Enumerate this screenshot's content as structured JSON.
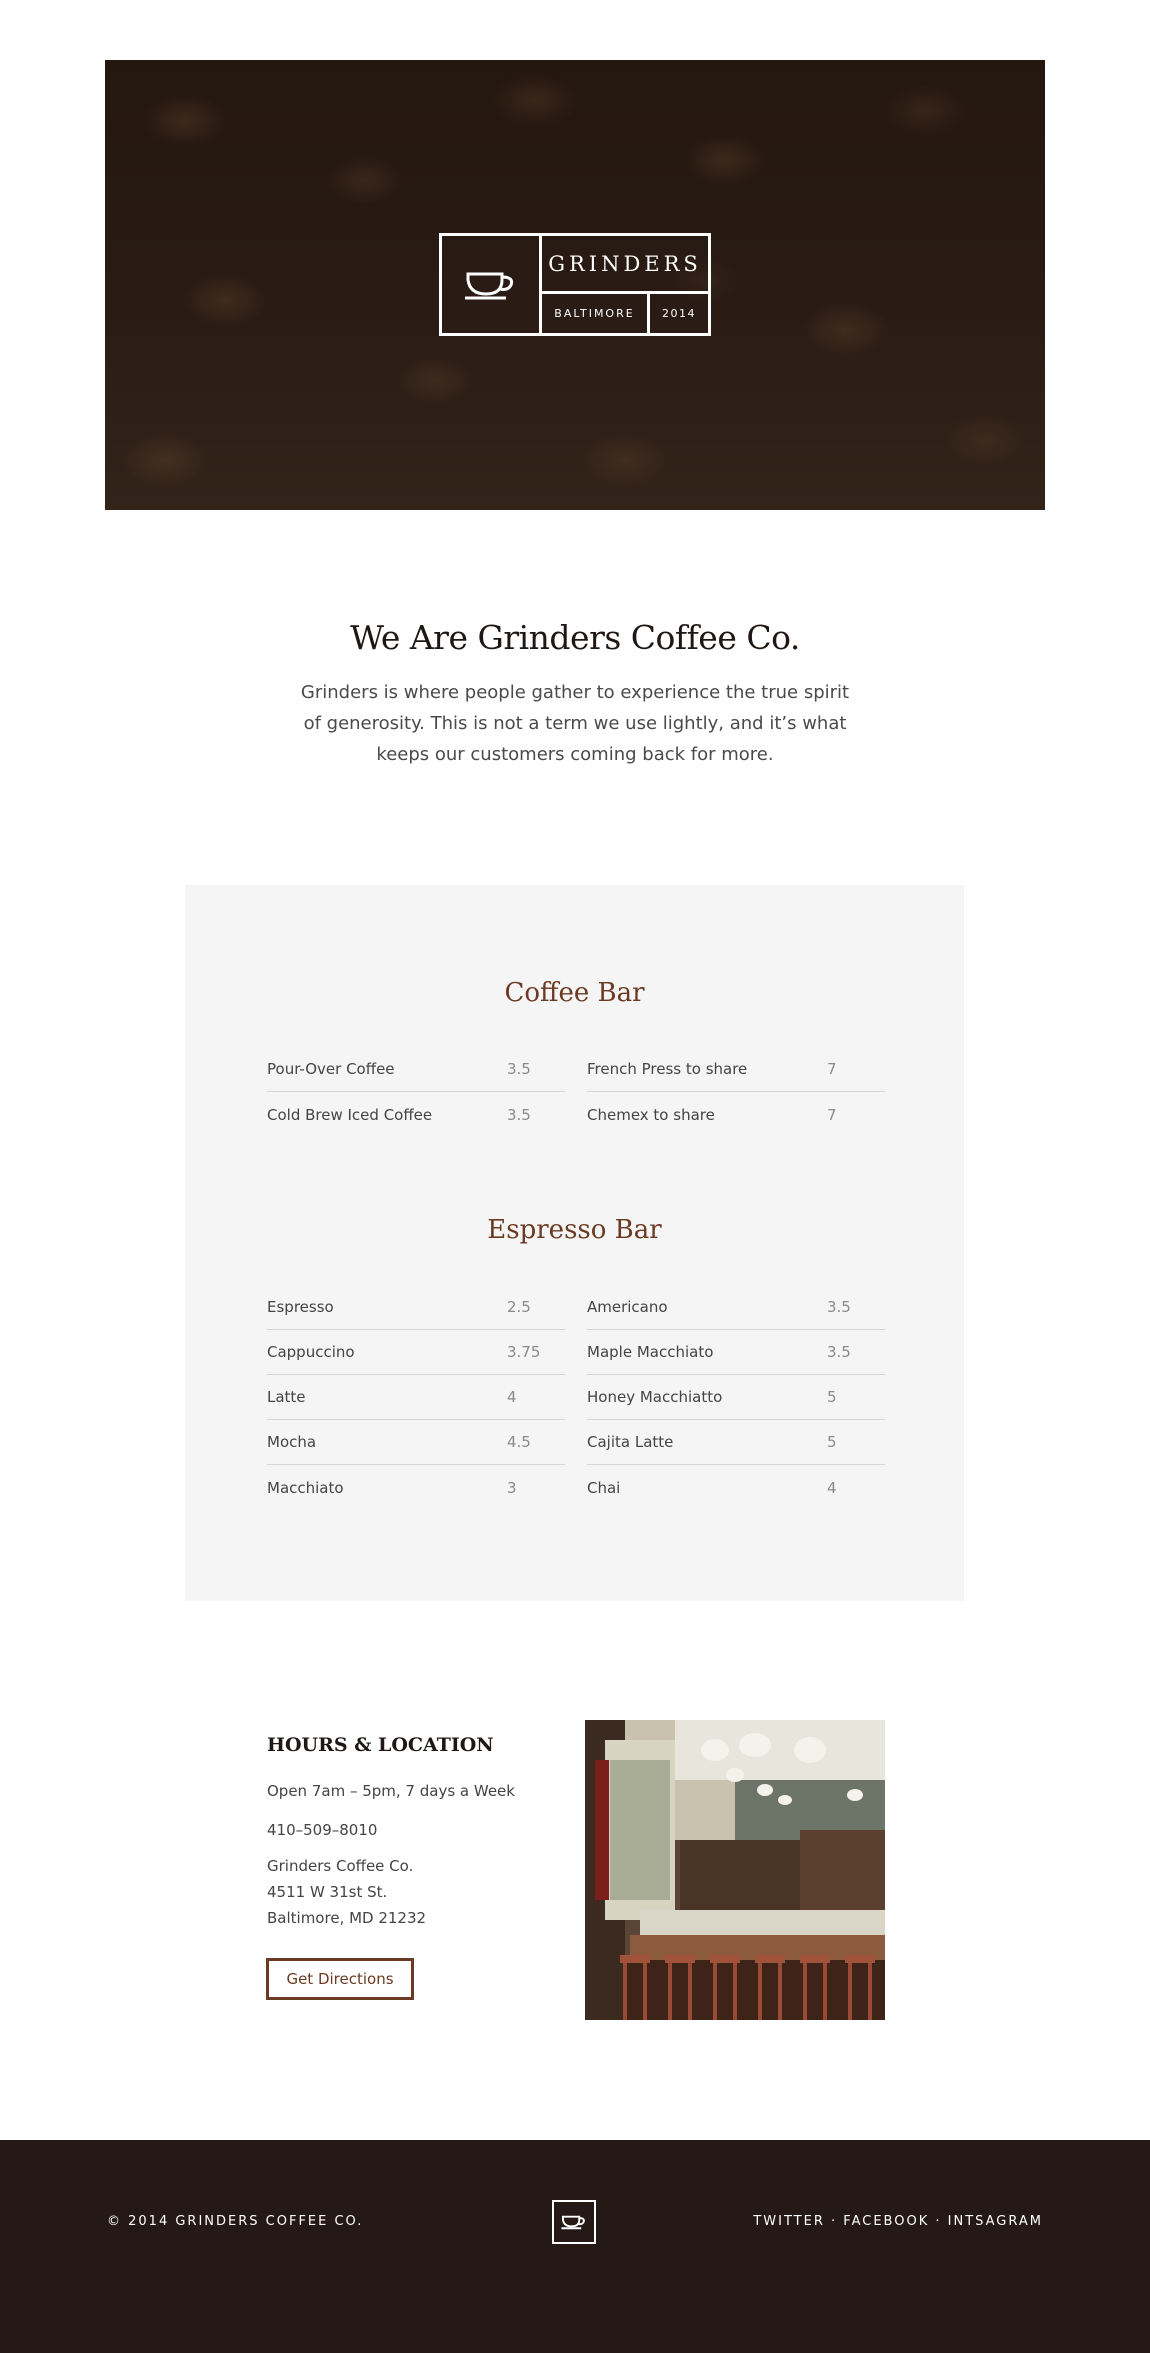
{
  "hero": {
    "brand": "GRINDERS",
    "city": "BALTIMORE",
    "year": "2014"
  },
  "intro": {
    "title": "We Are Grinders Coffee Co.",
    "body": "Grinders is where people gather to experience the true spirit of generosity. This is not a term we use lightly, and it’s what keeps our customers coming back for more."
  },
  "menu": {
    "coffee_bar": {
      "title": "Coffee Bar",
      "left": [
        {
          "name": "Pour-Over Coffee",
          "price": "3.5"
        },
        {
          "name": "Cold Brew Iced Coffee",
          "price": "3.5"
        }
      ],
      "right": [
        {
          "name": "French Press to share",
          "price": "7"
        },
        {
          "name": "Chemex to share",
          "price": "7"
        }
      ]
    },
    "espresso_bar": {
      "title": "Espresso Bar",
      "left": [
        {
          "name": "Espresso",
          "price": "2.5"
        },
        {
          "name": "Cappuccino",
          "price": "3.75"
        },
        {
          "name": "Latte",
          "price": "4"
        },
        {
          "name": "Mocha",
          "price": "4.5"
        },
        {
          "name": "Macchiato",
          "price": "3"
        }
      ],
      "right": [
        {
          "name": "Americano",
          "price": "3.5"
        },
        {
          "name": "Maple Macchiato",
          "price": "3.5"
        },
        {
          "name": "Honey Macchiatto",
          "price": "5"
        },
        {
          "name": "Cajita Latte",
          "price": "5"
        },
        {
          "name": "Chai",
          "price": "4"
        }
      ]
    }
  },
  "hours": {
    "title": "HOURS & LOCATION",
    "schedule": "Open 7am – 5pm, 7 days a Week",
    "phone": "410–509–8010",
    "address_line1": "Grinders Coffee Co.",
    "address_line2": "4511 W 31st St.",
    "address_line3": "Baltimore, MD 21232",
    "directions_label": "Get Directions"
  },
  "footer": {
    "copyright": "© 2014 GRINDERS COFFEE CO.",
    "twitter": "TWITTER",
    "facebook": "FACEBOOK",
    "instagram": "INTSAGRAM",
    "separator": "·"
  },
  "colors": {
    "accent": "#6b3a22",
    "footer_bg": "#241915",
    "hero_bg": "#2a1c14",
    "menu_bg": "#f5f5f5"
  }
}
